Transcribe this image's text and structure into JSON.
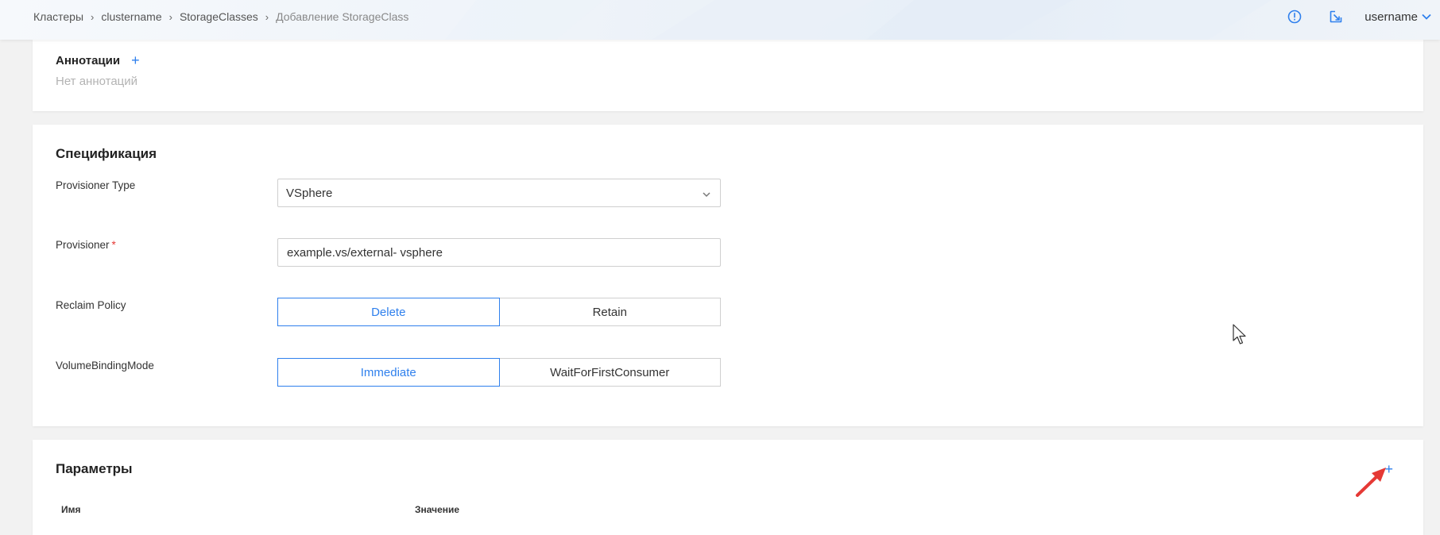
{
  "breadcrumb": {
    "items": [
      "Кластеры",
      "clustername",
      "StorageClasses",
      "Добавление StorageClass"
    ],
    "separator": "›"
  },
  "header": {
    "username": "username",
    "icons": [
      "info-circle-icon",
      "external-link-icon",
      "chevron-down-icon"
    ]
  },
  "annotations": {
    "title": "Аннотации",
    "add_label": "+",
    "empty_text": "Нет аннотаций"
  },
  "spec": {
    "title": "Спецификация",
    "provisioner_type": {
      "label": "Provisioner Type",
      "value": "VSphere"
    },
    "provisioner": {
      "label": "Provisioner",
      "required_mark": "*",
      "value": "example.vs/external- vsphere"
    },
    "reclaim_policy": {
      "label": "Reclaim Policy",
      "options": [
        "Delete",
        "Retain"
      ],
      "selected": "Delete"
    },
    "volume_binding_mode": {
      "label": "VolumeBindingMode",
      "options": [
        "Immediate",
        "WaitForFirstConsumer"
      ],
      "selected": "Immediate"
    }
  },
  "params": {
    "title": "Параметры",
    "add_label": "+",
    "columns": [
      "Имя",
      "Значение"
    ]
  },
  "colors": {
    "accent": "#2f80ed",
    "required": "#e53935",
    "annotation_arrow": "#e53935"
  }
}
